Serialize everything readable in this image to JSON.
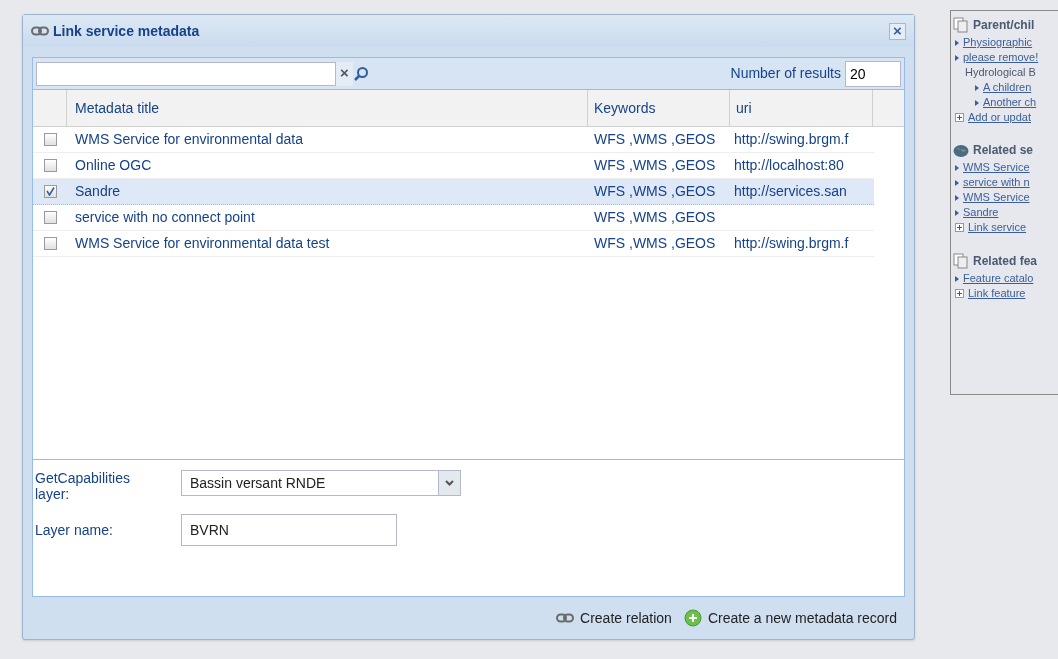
{
  "dialog": {
    "title": "Link service metadata",
    "close": "×"
  },
  "toolbar": {
    "search": {
      "clear": "×"
    },
    "results_label": "Number of results",
    "results_value": "20"
  },
  "table": {
    "columns": [
      "Metadata title",
      "Keywords",
      "uri"
    ],
    "rows": [
      {
        "title": "WMS Service for environmental data",
        "keywords": "WFS ,WMS ,GEOS",
        "uri": "http://swing.brgm.f",
        "selected": false
      },
      {
        "title": "Online OGC",
        "keywords": "WFS ,WMS ,GEOS",
        "uri": "http://localhost:80",
        "selected": false
      },
      {
        "title": "Sandre",
        "keywords": "WFS ,WMS ,GEOS",
        "uri": "http://services.san",
        "selected": true
      },
      {
        "title": "service with no connect point",
        "keywords": "WFS ,WMS ,GEOS",
        "selected": false
      },
      {
        "title": "WMS Service for environmental data test",
        "keywords": "WFS ,WMS ,GEOS",
        "uri": "http://swing.brgm.f",
        "selected": false
      }
    ]
  },
  "form": {
    "layer_label": "GetCapabilities layer:",
    "layer_value": "Bassin versant RNDE",
    "name_label": "Layer name:",
    "name_value": "BVRN"
  },
  "footer": {
    "buttons": [
      {
        "kind": "link",
        "label": "Create relation"
      },
      {
        "kind": "add",
        "label": "Create a new metadata record"
      }
    ]
  },
  "side_panel": {
    "sections": [
      {
        "kind": "pages",
        "title": "Parent/chil",
        "items": [
          {
            "kind": "link",
            "text": "Physiographic"
          },
          {
            "kind": "link",
            "text": "please remove!"
          },
          {
            "kind": "text",
            "text": "Hydrological B"
          },
          {
            "kind": "child",
            "text": "A children"
          },
          {
            "kind": "child",
            "text": "Another ch"
          },
          {
            "kind": "add",
            "text": "Add or updat"
          }
        ]
      },
      {
        "kind": "globe",
        "title": "Related se",
        "items": [
          {
            "kind": "link",
            "text": "WMS Service"
          },
          {
            "kind": "link",
            "text": "service with n"
          },
          {
            "kind": "link",
            "text": "WMS Service"
          },
          {
            "kind": "link",
            "text": "Sandre"
          },
          {
            "kind": "add",
            "text": "Link service"
          }
        ]
      },
      {
        "kind": "pages",
        "title": "Related fea",
        "items": [
          {
            "kind": "link",
            "text": "Feature catalo"
          },
          {
            "kind": "add",
            "text": "Link feature"
          }
        ]
      }
    ]
  }
}
